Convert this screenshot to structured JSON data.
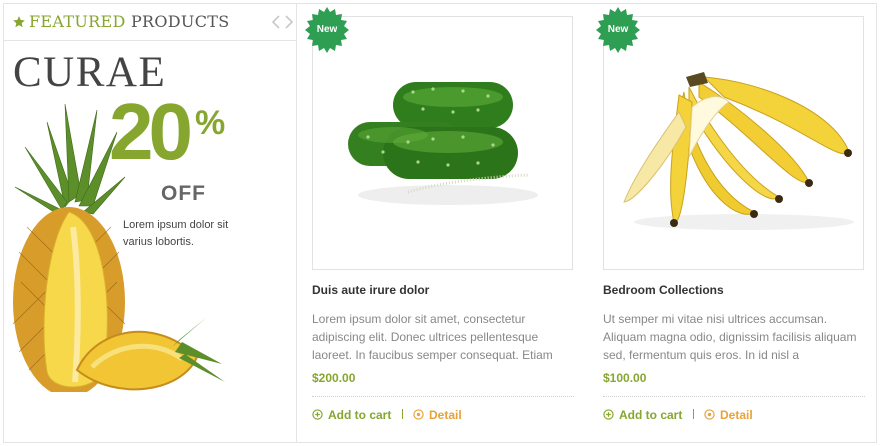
{
  "featured": {
    "title_highlight": "FEATURED",
    "title_rest": "PRODUCTS",
    "icons": {
      "star": "star-icon",
      "prev": "chevron-left-icon",
      "next": "chevron-right-icon"
    }
  },
  "promo": {
    "brand": "CURAE",
    "discount": "20",
    "percent_sign": "%",
    "off": "OFF",
    "description": "Lorem ipsum dolor sit varius lobortis."
  },
  "products": [
    {
      "badge": "New",
      "title": "Duis aute irure dolor",
      "description": "Lorem ipsum dolor sit amet, consectetur adipiscing elit. Donec ultrices pellentesque laoreet. In faucibus semper consequat. Etiam",
      "price": "$200.00",
      "add_to_cart": "Add to cart",
      "detail": "Detail",
      "image": "cucumber-image"
    },
    {
      "badge": "New",
      "title": "Bedroom Collections",
      "description": "Ut semper mi vitae nisi ultrices accumsan. Aliquam magna odio, dignissim facilisis aliquam sed, fermentum quis eros. In id nisl a",
      "price": "$100.00",
      "add_to_cart": "Add to cart",
      "detail": "Detail",
      "image": "banana-image"
    }
  ],
  "colors": {
    "accent_green": "#86a62f",
    "badge_green": "#2e9e52",
    "detail_orange": "#e8a23a"
  }
}
